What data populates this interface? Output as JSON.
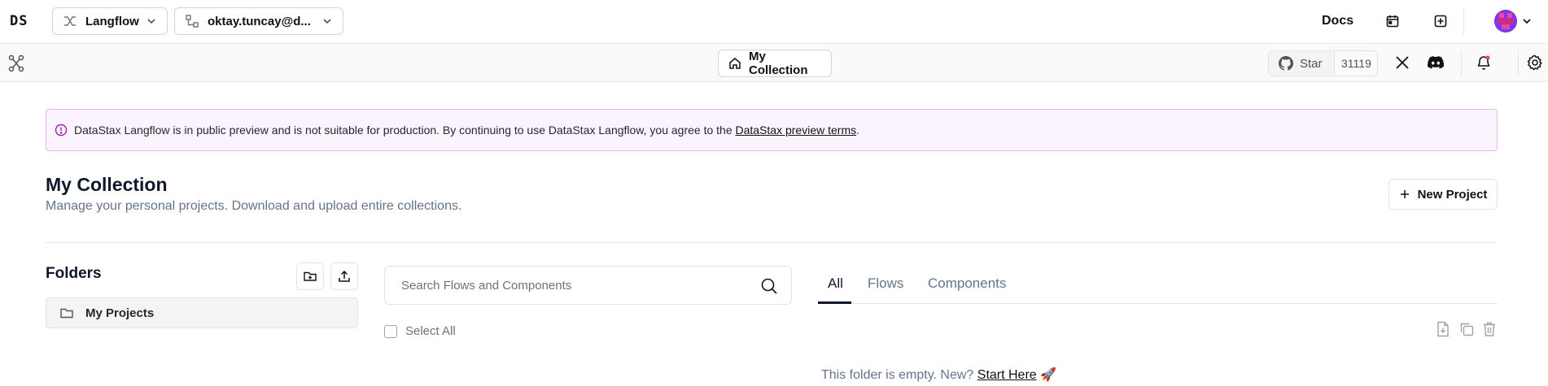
{
  "header": {
    "logo_text": "DS",
    "app_selector": {
      "label": "Langflow"
    },
    "user_selector": {
      "label": "oktay.tuncay@d..."
    },
    "docs_label": "Docs"
  },
  "subbar": {
    "breadcrumb": "My Collection",
    "github": {
      "star_label": "Star",
      "star_count": "31119"
    }
  },
  "banner": {
    "text": "DataStax Langflow is in public preview and is not suitable for production. By continuing to use DataStax Langflow, you agree to the ",
    "link_text": "DataStax preview terms",
    "suffix": "."
  },
  "page": {
    "title": "My Collection",
    "subtitle": "Manage your personal projects. Download and upload entire collections.",
    "new_project_label": "New Project"
  },
  "folders": {
    "title": "Folders",
    "items": [
      {
        "label": "My Projects"
      }
    ]
  },
  "search": {
    "placeholder": "Search Flows and Components"
  },
  "tabs": [
    {
      "label": "All",
      "active": true
    },
    {
      "label": "Flows",
      "active": false
    },
    {
      "label": "Components",
      "active": false
    }
  ],
  "select_all_label": "Select All",
  "empty_state": {
    "text": "This folder is empty. New? ",
    "link_text": "Start Here",
    "emoji": "🚀"
  },
  "colors": {
    "banner_bg": "#fbf4ff",
    "banner_border": "#e9b5f5",
    "text_primary": "#0f172a",
    "text_muted": "#64748b",
    "notification_dot": "#ef4444"
  }
}
